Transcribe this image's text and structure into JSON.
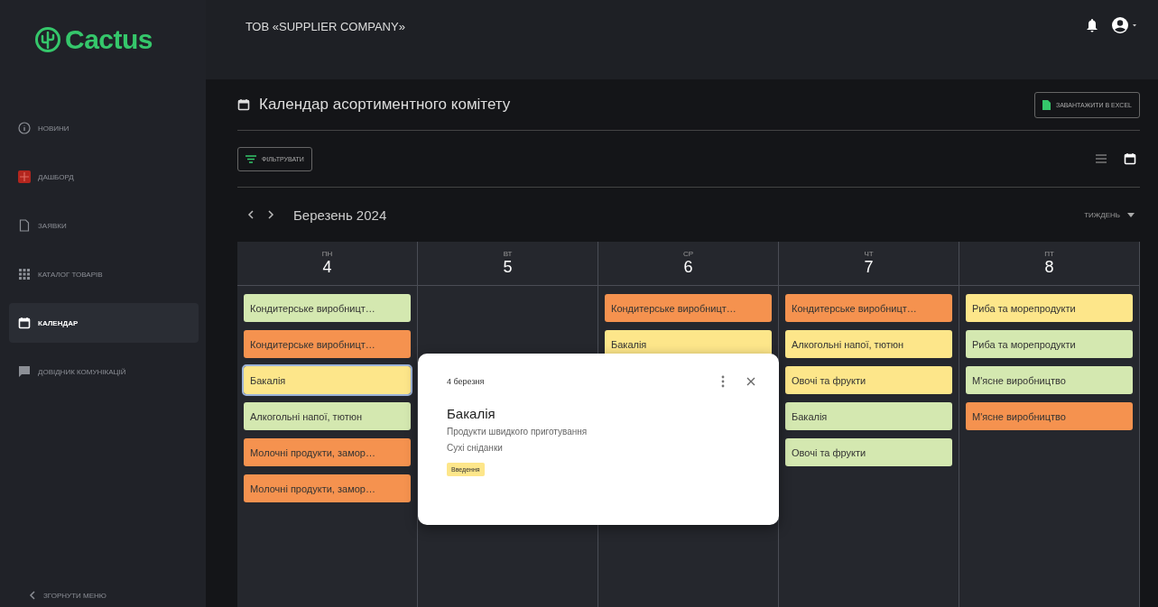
{
  "logo": {
    "text": "Cactus"
  },
  "sidebar": {
    "items": [
      {
        "label": "НОВИНИ",
        "kind": "info",
        "selected": false
      },
      {
        "label": "ДАШБОРД",
        "kind": "dashboard",
        "selected": false
      },
      {
        "label": "ЗАЯВКИ",
        "kind": "document",
        "selected": false
      },
      {
        "label": "КАТАЛОГ ТОВАРІВ",
        "kind": "grid",
        "selected": false
      },
      {
        "label": "КАЛЕНДАР",
        "kind": "calendar",
        "selected": true
      },
      {
        "label": "ДОВІДНИК КОМУНІКАЦІЙ",
        "kind": "chat",
        "selected": false
      }
    ],
    "collapse": "ЗГОРНУТИ МЕНЮ"
  },
  "header": {
    "company": "ТОВ «SUPPLIER COMPANY»"
  },
  "page": {
    "title": "Календар асортиментного комітету",
    "export_button": "ЗАВАНТАЖИТИ В EXCEL",
    "filter_button": "ФІЛЬТРУВАТИ",
    "views": [
      {
        "kind": "list",
        "selected": false
      },
      {
        "kind": "calendar",
        "selected": true
      }
    ]
  },
  "calendar": {
    "month": "Березень 2024",
    "range": "ТИЖДЕНЬ",
    "days": [
      {
        "weekday": "ПН",
        "day": "4",
        "events": [
          {
            "title": "Кондитерське виробницт…",
            "color": "#d4e8b0",
            "selected": false
          },
          {
            "title": "Кондитерське виробницт…",
            "color": "#f5924f",
            "selected": false
          },
          {
            "title": "Бакалія",
            "color": "#fde68a",
            "selected": true
          },
          {
            "title": "Алкогольні напої, тютюн",
            "color": "#d4e8b0",
            "selected": false
          },
          {
            "title": "Молочні продукти, замор…",
            "color": "#f5924f",
            "selected": false
          },
          {
            "title": "Молочні продукти, замор…",
            "color": "#f5924f",
            "selected": false
          }
        ]
      },
      {
        "weekday": "ВТ",
        "day": "5"
      },
      {
        "weekday": "СР",
        "day": "6",
        "events": [
          {
            "title": "Кондитерське виробницт…",
            "color": "#f5924f",
            "selected": false
          },
          {
            "title": "Бакалія",
            "color": "#fde68a",
            "selected": false
          }
        ]
      },
      {
        "weekday": "ЧТ",
        "day": "7",
        "events": [
          {
            "title": "Кондитерське виробницт…",
            "color": "#f5924f",
            "selected": false
          },
          {
            "title": "Алкогольні напої, тютюн",
            "color": "#fde68a",
            "selected": false
          },
          {
            "title": "Овочі та фрукти",
            "color": "#fde68a",
            "selected": false
          },
          {
            "title": "Бакалія",
            "color": "#d4e8b0",
            "selected": false
          },
          {
            "title": "Овочі та фрукти",
            "color": "#d4e8b0",
            "selected": false
          }
        ]
      },
      {
        "weekday": "ПТ",
        "day": "8",
        "events": [
          {
            "title": "Риба та морепродукти",
            "color": "#fde68a",
            "selected": false
          },
          {
            "title": "Риба та морепродукти",
            "color": "#d4e8b0",
            "selected": false
          },
          {
            "title": "М'ясне виробництво",
            "color": "#d4e8b0",
            "selected": false
          },
          {
            "title": "М'ясне виробництво",
            "color": "#f5924f",
            "selected": false
          }
        ]
      }
    ]
  },
  "popup": {
    "date": "4 березня",
    "title": "Бакалія",
    "lines": [
      "Продукти швидкого приготування",
      "Сухі сніданки"
    ],
    "tag": {
      "text": "Введення",
      "color": "#fde68a"
    }
  }
}
